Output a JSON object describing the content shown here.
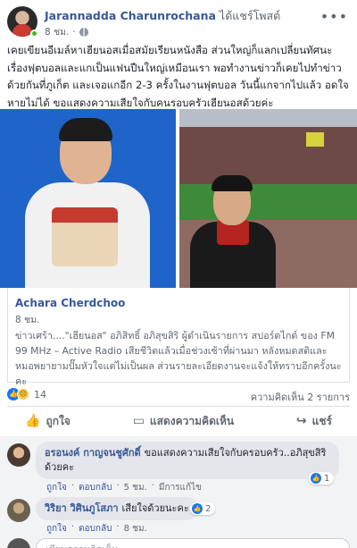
{
  "post": {
    "author": "Jarannadda Charunrochana",
    "action": "ได้แชร์โพสต์",
    "time": "8 ชม.",
    "more_icon": "more-icon",
    "text": "เคยเขียนอีเมล์หาเฮียนอสเมื่อสมัยเรียนหนังสือ ส่วนใหญ่ก็แลกเปลี่ยนทัศนะเรื่องฟุตบอลและแกเป็นแฟนปืนใหญ่เหมือนเรา พอทำงานข่าวก็เคยไปทำข่าวด้วยกันที่ภูเก็ต และเจอแกอีก 2-3 ครั้งในงานฟุตบอล วันนี้แกจากไปแล้ว อดใจหายไม่ได้ ขอแสดงความเสียใจกับคนรอบครัวเฮียนอสด้วยค่ะ"
  },
  "shared": {
    "author": "Achara Cherdchoo",
    "time": "8 ชม.",
    "text": "ข่าวเศร้า....\"เฮียนอส\" อภิสิทธิ์ อภิสุขสิริ ผู้ดำเนินรายการ สปอร์ตไกด์ ของ FM 99 MHz – Active Radio เสียชีวิตแล้วเมื่อช่วงเช้าที่ผ่านมา หลังหมดสติและหมอพยายามปั๊มหัวใจแต่ไม่เป็นผล ส่วนรายละเอียดงานจะแจ้งให้ทราบอีกครั้งนะคะ"
  },
  "reactions": {
    "count": "14",
    "comments": "ความคิดเห็น 2 รายการ"
  },
  "actions": {
    "like": "ถูกใจ",
    "comment": "แสดงความคิดเห็น",
    "share": "แชร์"
  },
  "comments": [
    {
      "name": "อรอนงค์ กาญจนชูศักดิ์",
      "text": "ขอแสดงความเสียใจกับครอบครัว..อภิสุขสิริด้วยคะ",
      "like": "ถูกใจ",
      "reply": "ตอบกลับ",
      "time": "5 ชม.",
      "edited": "มีการแก้ไข",
      "reactions": "1"
    },
    {
      "name": "วิริยา วิศินภูโสภา",
      "text": "เสียใจด้วยนะคะ",
      "like": "ถูกใจ",
      "reply": "ตอบกลับ",
      "time": "8 ชม.",
      "reactions": "2"
    }
  ],
  "write_placeholder": "เขียนความคิดเห็น..."
}
